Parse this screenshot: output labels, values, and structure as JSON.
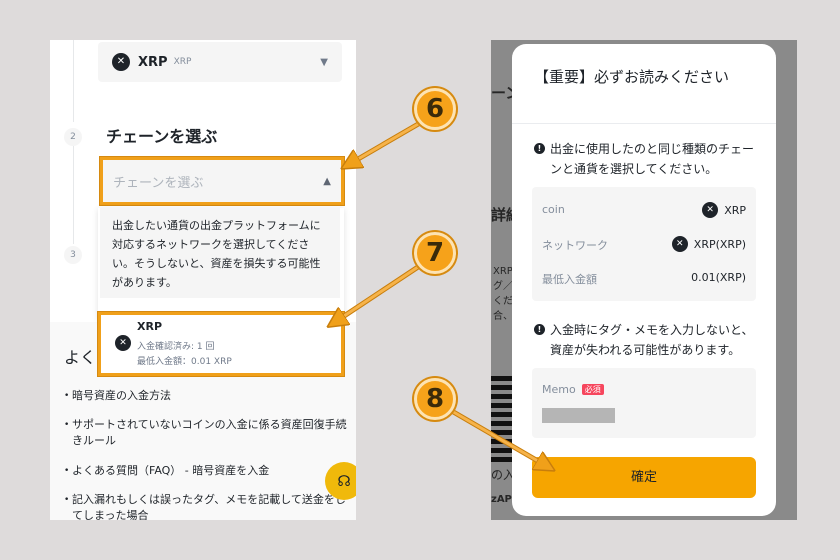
{
  "left": {
    "coin_select": {
      "icon": "xrp-icon",
      "name": "XRP",
      "sub": "XRP"
    },
    "steps": {
      "two": "2",
      "three": "3"
    },
    "step2_title": "チェーンを選ぶ",
    "chain_select_placeholder": "チェーンを選ぶ",
    "dropdown_notice": "出金したい通貨の出金プラットフォームに対応するネットワークを選択してください。そうしないと、資産を損失する可能性があります。",
    "option": {
      "title": "XRP",
      "confirmations": "入金確認済み: 1 回",
      "min_deposit": "最低入金額：0.01 XRP"
    },
    "faq_heading": "よく",
    "faq_items": [
      "暗号資産の入金方法",
      "サポートされていないコインの入金に係る資産回復手続きルール",
      "よくある質問（FAQ） - 暗号資産を入金",
      "記入漏れもしくは誤ったタグ、メモを記載して送金をしてしまった場合"
    ]
  },
  "annotations": {
    "six": "6",
    "seven": "7",
    "eight": "8"
  },
  "background_fragments": {
    "chain": "ーン",
    "details": "詳細",
    "side_text": "XRP\nグ／\nくだ\n合、",
    "bottom1": "の入",
    "bottom2": "zAP"
  },
  "modal": {
    "title": "【重要】必ずお読みください",
    "notice1": "出金に使用したのと同じ種類のチェーンと通貨を選択してください。",
    "rows": [
      {
        "label": "coin",
        "value": "XRP"
      },
      {
        "label": "ネットワーク",
        "value": "XRP(XRP)"
      },
      {
        "label": "最低入金額",
        "value": "0.01(XRP)"
      }
    ],
    "notice2": "入金時にタグ・メモを入力しないと、資産が失われる可能性があります。",
    "memo_label": "Memo",
    "memo_required": "必須",
    "confirm": "確定"
  },
  "colors": {
    "accent": "#f6a500",
    "annotation": "#f0a01a"
  }
}
